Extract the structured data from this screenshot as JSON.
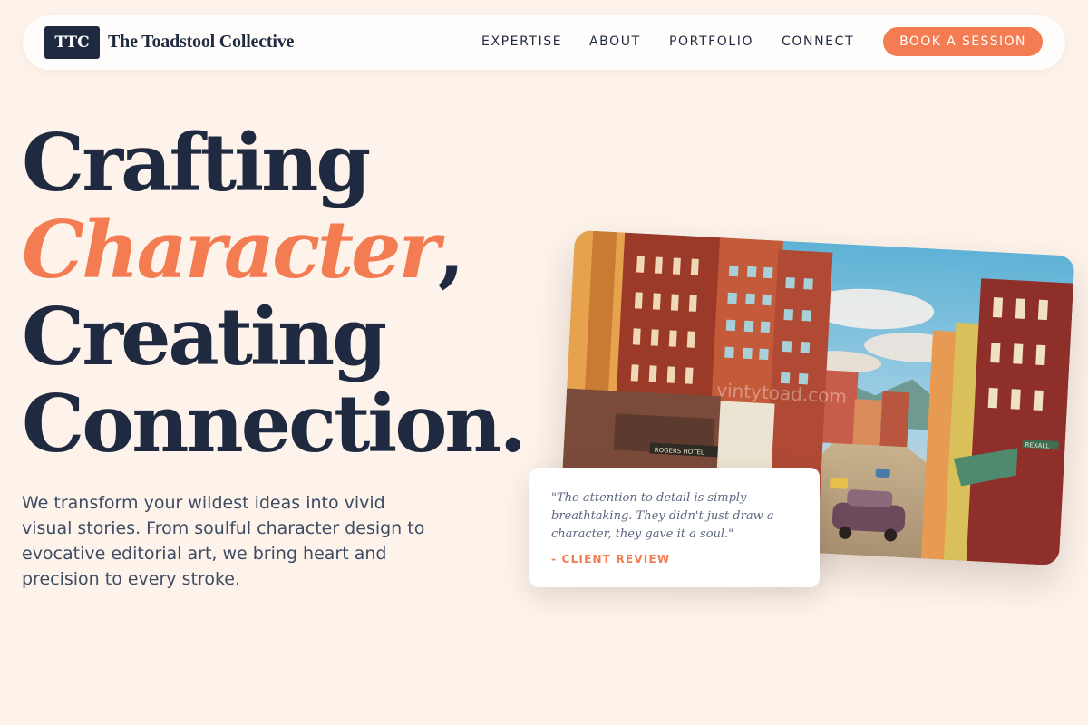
{
  "nav": {
    "logo_mark": "TTC",
    "brand_name": "The Toadstool Collective",
    "links": [
      {
        "label": "EXPERTISE"
      },
      {
        "label": "ABOUT"
      },
      {
        "label": "PORTFOLIO"
      },
      {
        "label": "CONNECT"
      }
    ],
    "cta_label": "BOOK A SESSION"
  },
  "hero": {
    "title_line1": "Crafting",
    "title_accent": "Character",
    "title_comma": ",",
    "title_line3": "Creating",
    "title_line4": "Connection.",
    "subtitle": "We transform your wildest ideas into vivid visual stories. From soulful character design to evocative editorial art, we bring heart and precision to every stroke."
  },
  "showcase": {
    "image_subject": "vintage-postcard-street-scene",
    "watermark": "vintytoad.com",
    "sign_left": "ROGERS HOTEL",
    "sign_right": "REXALL"
  },
  "review": {
    "quote": "\"The attention to detail is simply breathtaking. They didn't just draw a character, they gave it a soul.\"",
    "label": "- CLIENT REVIEW"
  },
  "colors": {
    "background": "#fdf3eb",
    "navy": "#1f2a40",
    "accent": "#f47c52"
  }
}
